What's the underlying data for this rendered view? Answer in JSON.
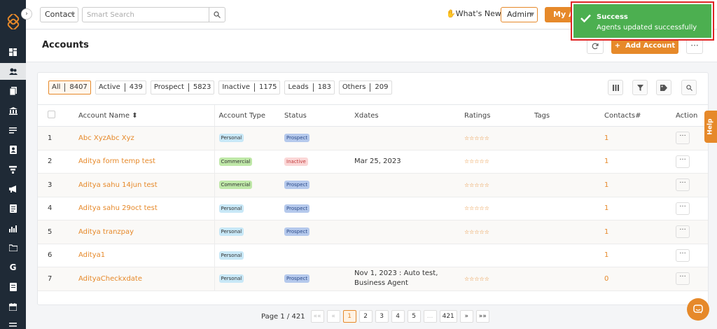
{
  "topbar": {
    "contact_select": "Contact",
    "search_placeholder": "Smart Search",
    "whats_new": "What's New",
    "admin_select": "Admin",
    "my_agent_button": "My Ag"
  },
  "toast": {
    "title": "Success",
    "message": "Agents updated successfully",
    "color": "#4caf50"
  },
  "page": {
    "title": "Accounts",
    "add_button": "Add Account",
    "more": "···"
  },
  "filters": [
    {
      "label": "All",
      "count": "8407"
    },
    {
      "label": "Active",
      "count": "439"
    },
    {
      "label": "Prospect",
      "count": "5823"
    },
    {
      "label": "Inactive",
      "count": "1175"
    },
    {
      "label": "Leads",
      "count": "183"
    },
    {
      "label": "Others",
      "count": "209"
    }
  ],
  "table": {
    "headers": {
      "name": "Account Name ⬍",
      "type": "Account Type",
      "status": "Status",
      "xdates": "Xdates",
      "ratings": "Ratings",
      "tags": "Tags",
      "contacts": "Contacts#",
      "action": "Action"
    },
    "rows": [
      {
        "num": "1",
        "name": "Abc XyzAbc Xyz",
        "type": "Personal",
        "status": "Prospect",
        "xdates": "",
        "contacts": "1"
      },
      {
        "num": "2",
        "name": "Aditya form temp test",
        "type": "Commercial",
        "status": "Inactive",
        "xdates": "Mar 25, 2023",
        "contacts": "1"
      },
      {
        "num": "3",
        "name": "Aditya sahu 14jun test",
        "type": "Commercial",
        "status": "Prospect",
        "xdates": "",
        "contacts": "1"
      },
      {
        "num": "4",
        "name": "Aditya sahu 29oct test",
        "type": "Personal",
        "status": "Prospect",
        "xdates": "",
        "contacts": "1"
      },
      {
        "num": "5",
        "name": "Aditya tranzpay",
        "type": "Personal",
        "status": "Prospect",
        "xdates": "",
        "contacts": "1"
      },
      {
        "num": "6",
        "name": "Aditya1",
        "type": "Personal",
        "status": "",
        "xdates": "",
        "contacts": "1"
      },
      {
        "num": "7",
        "name": "AdityaCheckxdate",
        "type": "Personal",
        "status": "Prospect",
        "xdates": "Nov 1, 2023 : Auto test, Business Agent",
        "contacts": "0"
      }
    ],
    "stars": "☆☆☆☆☆",
    "row_action": "···"
  },
  "pagination": {
    "label": "Page 1 / 421",
    "first": "««",
    "prev": "«",
    "pages": [
      "1",
      "2",
      "3",
      "4",
      "5",
      "...",
      "421"
    ],
    "next": "»",
    "last": "»»"
  },
  "help": "Help",
  "colors": {
    "accent": "#e6892a",
    "sidebar": "#1f2a36"
  }
}
